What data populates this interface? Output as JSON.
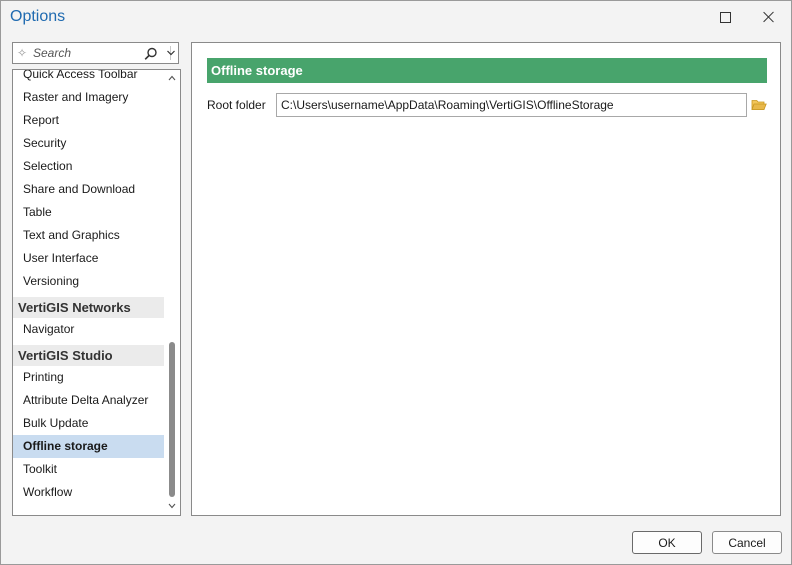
{
  "window": {
    "title": "Options"
  },
  "search": {
    "placeholder": "Search"
  },
  "sidebar": {
    "items_a": [
      "Quick Access Toolbar",
      "Raster and Imagery",
      "Report",
      "Security",
      "Selection",
      "Share and Download",
      "Table",
      "Text and Graphics",
      "User Interface",
      "Versioning"
    ],
    "group_networks": "VertiGIS Networks",
    "networks_items": [
      "Navigator"
    ],
    "group_studio": "VertiGIS Studio",
    "studio_items": [
      "Printing",
      "Attribute Delta Analyzer",
      "Bulk Update",
      "Offline storage",
      "Toolkit",
      "Workflow"
    ]
  },
  "panel": {
    "header": "Offline storage",
    "root_folder_label": "Root folder",
    "root_folder_value": "C:\\Users\\username\\AppData\\Roaming\\VertiGIS\\OfflineStorage"
  },
  "footer": {
    "ok_label": "OK",
    "cancel_label": "Cancel"
  },
  "colors": {
    "accent_header": "#48a46c",
    "title_text": "#1f6ab0",
    "selection": "#c9dcf0",
    "folder_icon": "#e8b84a"
  }
}
